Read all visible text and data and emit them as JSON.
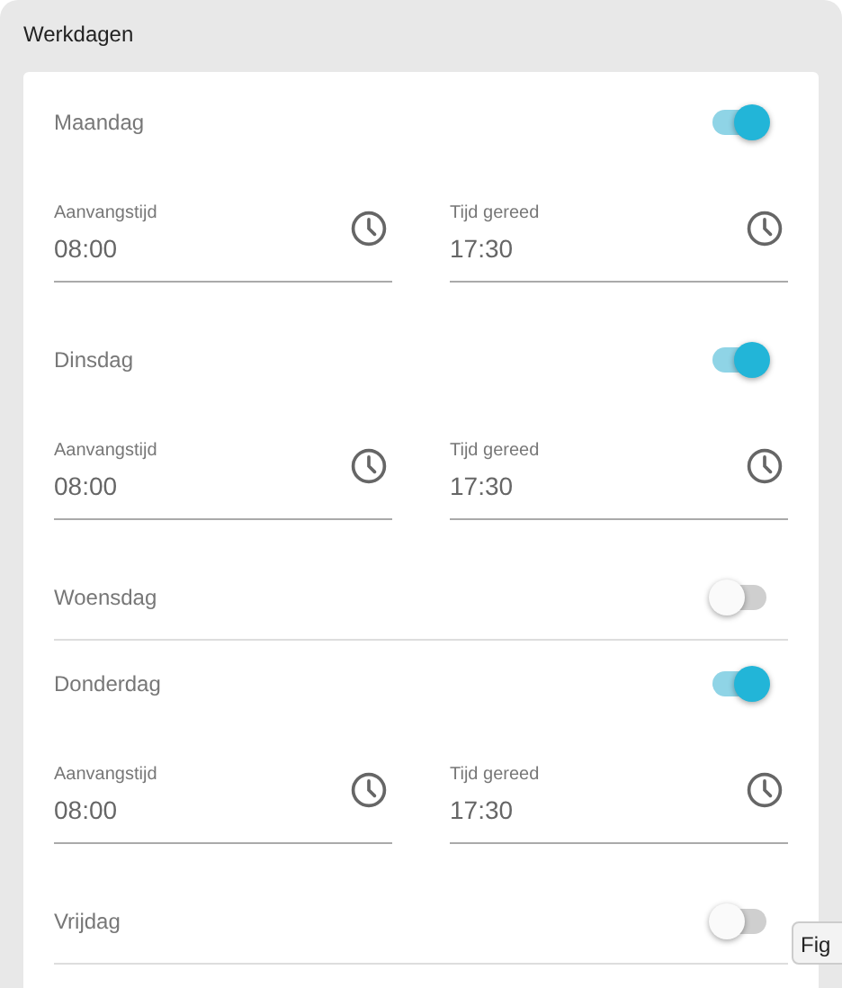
{
  "title": "Werkdagen",
  "days": [
    {
      "name": "Maandag",
      "enabled": true,
      "fields": [
        {
          "label": "Aanvangstijd",
          "value": "08:00"
        },
        {
          "label": "Tijd gereed",
          "value": "17:30"
        }
      ]
    },
    {
      "name": "Dinsdag",
      "enabled": true,
      "fields": [
        {
          "label": "Aanvangstijd",
          "value": "08:00"
        },
        {
          "label": "Tijd gereed",
          "value": "17:30"
        }
      ]
    },
    {
      "name": "Woensdag",
      "enabled": false
    },
    {
      "name": "Donderdag",
      "enabled": true,
      "fields": [
        {
          "label": "Aanvangstijd",
          "value": "08:00"
        },
        {
          "label": "Tijd gereed",
          "value": "17:30"
        }
      ]
    },
    {
      "name": "Vrijdag",
      "enabled": false
    }
  ],
  "tooltip": {
    "text": "Fig"
  }
}
